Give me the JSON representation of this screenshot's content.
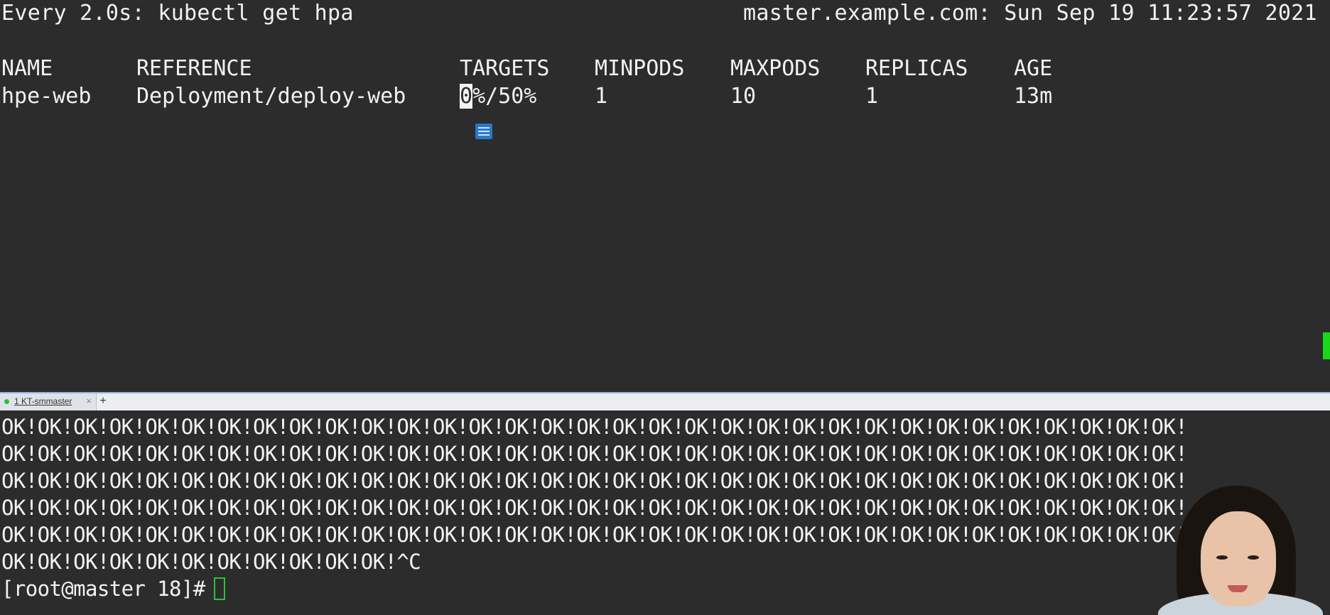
{
  "watch": {
    "header_left": "Every 2.0s: kubectl get hpa",
    "header_right": "master.example.com: Sun Sep 19 11:23:57 2021",
    "columns": [
      "NAME",
      "REFERENCE",
      "TARGETS",
      "MINPODS",
      "MAXPODS",
      "REPLICAS",
      "AGE"
    ],
    "row": {
      "name": "hpe-web",
      "reference": "Deployment/deploy-web",
      "targets_cursor": "0",
      "targets_rest": "%/50%",
      "minpods": "1",
      "maxpods": "10",
      "replicas": "1",
      "age": "13m"
    }
  },
  "tabbar": {
    "tab_label": "1 KT-smmaster",
    "close_glyph": "×",
    "add_glyph": "+"
  },
  "terminal": {
    "ok_lines": [
      "OK!OK!OK!OK!OK!OK!OK!OK!OK!OK!OK!OK!OK!OK!OK!OK!OK!OK!OK!OK!OK!OK!OK!OK!OK!OK!OK!OK!OK!OK!OK!OK!OK!",
      "OK!OK!OK!OK!OK!OK!OK!OK!OK!OK!OK!OK!OK!OK!OK!OK!OK!OK!OK!OK!OK!OK!OK!OK!OK!OK!OK!OK!OK!OK!OK!OK!OK!",
      "OK!OK!OK!OK!OK!OK!OK!OK!OK!OK!OK!OK!OK!OK!OK!OK!OK!OK!OK!OK!OK!OK!OK!OK!OK!OK!OK!OK!OK!OK!OK!OK!OK!",
      "OK!OK!OK!OK!OK!OK!OK!OK!OK!OK!OK!OK!OK!OK!OK!OK!OK!OK!OK!OK!OK!OK!OK!OK!OK!OK!OK!OK!OK!OK!OK!OK!OK!",
      "OK!OK!OK!OK!OK!OK!OK!OK!OK!OK!OK!OK!OK!OK!OK!OK!OK!OK!OK!OK!OK!OK!OK!OK!OK!OK!OK!OK!OK!OK!OK!OK!OK!",
      "OK!OK!OK!OK!OK!OK!OK!OK!OK!OK!OK!^C"
    ],
    "prompt": "[root@master 18]#"
  },
  "icons": {
    "note": "note-icon",
    "cursor": "terminal-cursor-icon"
  },
  "colors": {
    "background": "#2c2c2c",
    "text": "#f2f2f2",
    "cursor": "#2fbf3a",
    "tab_active_border": "#8fb6e6"
  }
}
